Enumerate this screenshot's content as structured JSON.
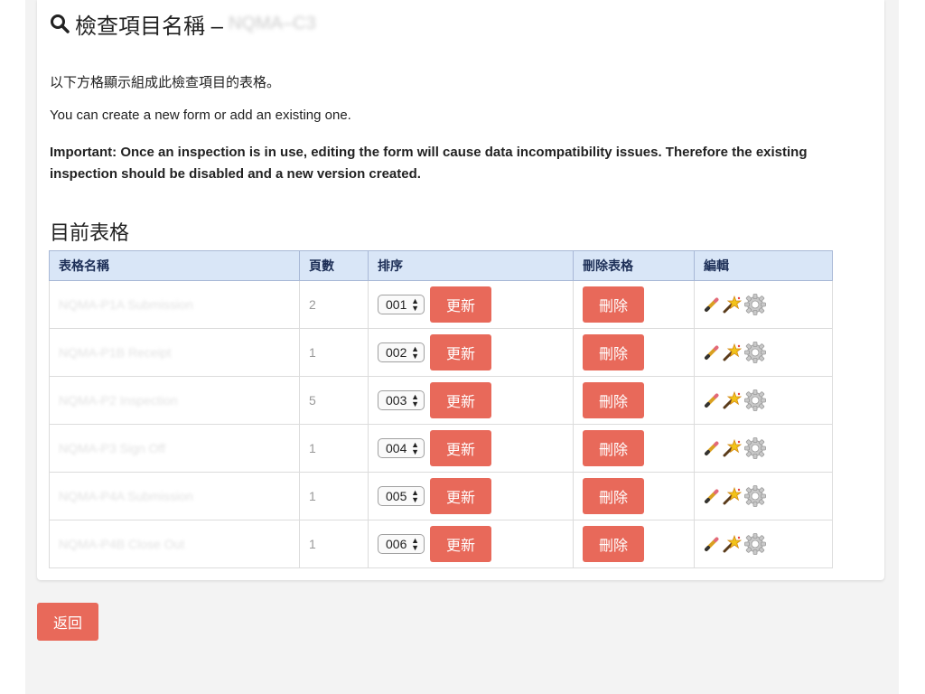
{
  "header": {
    "title": "檢查項目名稱 –",
    "title_suffix": "NQMA–C3"
  },
  "intro": {
    "line1": "以下方格顯示組成此檢查項目的表格。",
    "line2": "You can create a new form or add an existing one.",
    "important": "Important: Once an inspection is in use, editing the form will cause data incompatibility issues. Therefore the existing inspection should be disabled and a new version created."
  },
  "section_title": "目前表格",
  "table": {
    "headers": [
      "表格名稱",
      "頁數",
      "排序",
      "刪除表格",
      "編輯"
    ],
    "rows": [
      {
        "name": "NQMA-P1A Submission",
        "pages": "2",
        "order": "001",
        "update_label": "更新",
        "delete_label": "刪除"
      },
      {
        "name": "NQMA-P1B Receipt",
        "pages": "1",
        "order": "002",
        "update_label": "更新",
        "delete_label": "刪除"
      },
      {
        "name": "NQMA-P2 Inspection",
        "pages": "5",
        "order": "003",
        "update_label": "更新",
        "delete_label": "刪除"
      },
      {
        "name": "NQMA-P3 Sign Off",
        "pages": "1",
        "order": "004",
        "update_label": "更新",
        "delete_label": "刪除"
      },
      {
        "name": "NQMA-P4A Submission",
        "pages": "1",
        "order": "005",
        "update_label": "更新",
        "delete_label": "刪除"
      },
      {
        "name": "NQMA-P4B Close Out",
        "pages": "1",
        "order": "006",
        "update_label": "更新",
        "delete_label": "刪除"
      }
    ]
  },
  "back_button": "返回",
  "icons": {
    "title": "search-icon",
    "edit": [
      "pencil-icon",
      "magic-wand-icon",
      "gear-icon"
    ],
    "select": "sort-arrows-icon"
  },
  "colors": {
    "button": "#e8695a",
    "table_header_bg": "#d9e6f7",
    "table_border": "#7f95bb"
  }
}
